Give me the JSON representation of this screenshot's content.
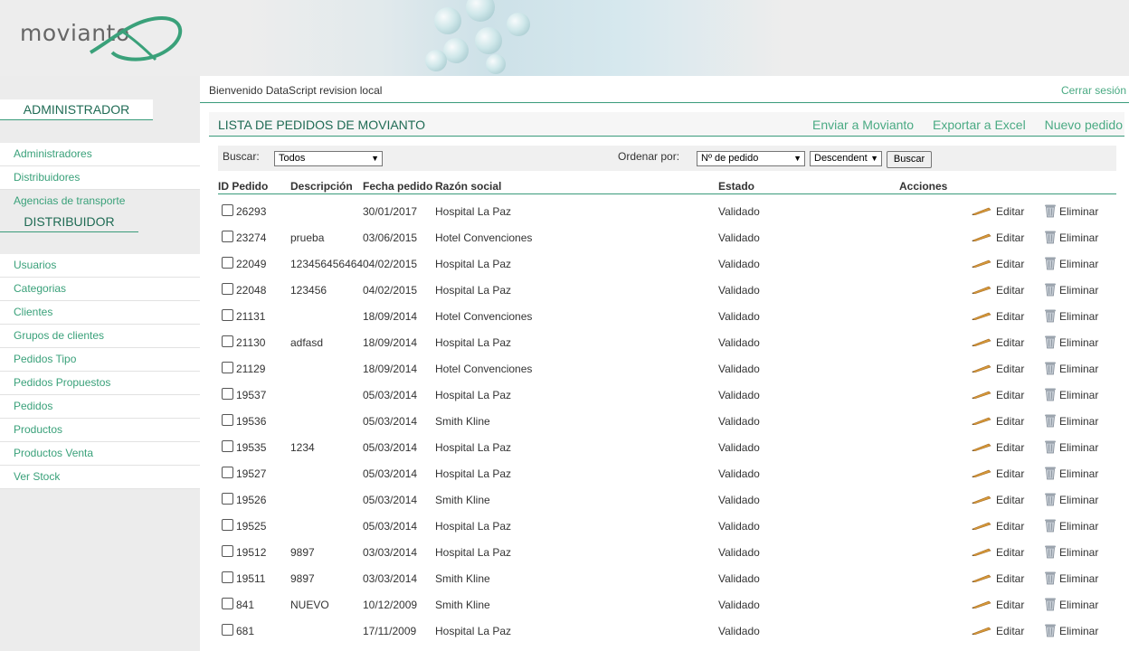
{
  "brand": {
    "logo_text": "movianto"
  },
  "welcome_bar": {
    "message": "Bienvenido DataScript revision local",
    "logout": "Cerrar sesión"
  },
  "sidebar": {
    "admin_section": "ADMINISTRADOR",
    "admin_items": [
      {
        "label": "Administradores"
      },
      {
        "label": "Distribuidores"
      },
      {
        "label": "Agencias de transporte"
      }
    ],
    "distrib_section": "DISTRIBUIDOR",
    "distrib_items": [
      {
        "label": "Usuarios"
      },
      {
        "label": "Categorias"
      },
      {
        "label": "Clientes"
      },
      {
        "label": "Grupos de clientes"
      },
      {
        "label": "Pedidos Tipo"
      },
      {
        "label": "Pedidos Propuestos"
      },
      {
        "label": "Pedidos"
      },
      {
        "label": "Productos"
      },
      {
        "label": "Productos Venta"
      },
      {
        "label": "Ver Stock"
      }
    ]
  },
  "main": {
    "title": "LISTA DE PEDIDOS DE MOVIANTO",
    "links": {
      "send": "Enviar a Movianto",
      "export": "Exportar a Excel",
      "new": "Nuevo pedido"
    },
    "filters": {
      "search_label": "Buscar:",
      "search_value": "Todos",
      "order_label": "Ordenar por:",
      "order_value": "Nº de pedido",
      "direction_value": "Descendent",
      "search_button": "Buscar"
    },
    "columns": {
      "id": "ID Pedido",
      "description": "Descripción",
      "date": "Fecha pedido",
      "company": "Razón social",
      "status": "Estado",
      "actions": "Acciones"
    },
    "edit_label": "Editar",
    "delete_label": "Eliminar",
    "rows": [
      {
        "id": "26293",
        "description": "",
        "date": "30/01/2017",
        "company": "Hospital La Paz",
        "status": "Validado"
      },
      {
        "id": "23274",
        "description": "prueba",
        "date": "03/06/2015",
        "company": "Hotel Convenciones",
        "status": "Validado"
      },
      {
        "id": "22049",
        "description": "123456456464",
        "date": "04/02/2015",
        "company": "Hospital La Paz",
        "status": "Validado"
      },
      {
        "id": "22048",
        "description": "123456",
        "date": "04/02/2015",
        "company": "Hospital La Paz",
        "status": "Validado"
      },
      {
        "id": "21131",
        "description": "",
        "date": "18/09/2014",
        "company": "Hotel Convenciones",
        "status": "Validado"
      },
      {
        "id": "21130",
        "description": "adfasd",
        "date": "18/09/2014",
        "company": "Hospital La Paz",
        "status": "Validado"
      },
      {
        "id": "21129",
        "description": "",
        "date": "18/09/2014",
        "company": "Hotel Convenciones",
        "status": "Validado"
      },
      {
        "id": "19537",
        "description": "",
        "date": "05/03/2014",
        "company": "Hospital La Paz",
        "status": "Validado"
      },
      {
        "id": "19536",
        "description": "",
        "date": "05/03/2014",
        "company": "Smith Kline",
        "status": "Validado"
      },
      {
        "id": "19535",
        "description": "1234",
        "date": "05/03/2014",
        "company": "Hospital La Paz",
        "status": "Validado"
      },
      {
        "id": "19527",
        "description": "",
        "date": "05/03/2014",
        "company": "Hospital La Paz",
        "status": "Validado"
      },
      {
        "id": "19526",
        "description": "",
        "date": "05/03/2014",
        "company": "Smith Kline",
        "status": "Validado"
      },
      {
        "id": "19525",
        "description": "",
        "date": "05/03/2014",
        "company": "Hospital La Paz",
        "status": "Validado"
      },
      {
        "id": "19512",
        "description": "9897",
        "date": "03/03/2014",
        "company": "Hospital La Paz",
        "status": "Validado"
      },
      {
        "id": "19511",
        "description": "9897",
        "date": "03/03/2014",
        "company": "Smith Kline",
        "status": "Validado"
      },
      {
        "id": "841",
        "description": "NUEVO",
        "date": "10/12/2009",
        "company": "Smith Kline",
        "status": "Validado"
      },
      {
        "id": "681",
        "description": "",
        "date": "17/11/2009",
        "company": "Hospital La Paz",
        "status": "Validado"
      }
    ]
  },
  "colors": {
    "accent": "#3aa17a",
    "title": "#1f6b54",
    "sidebar_bg": "#ececec"
  }
}
